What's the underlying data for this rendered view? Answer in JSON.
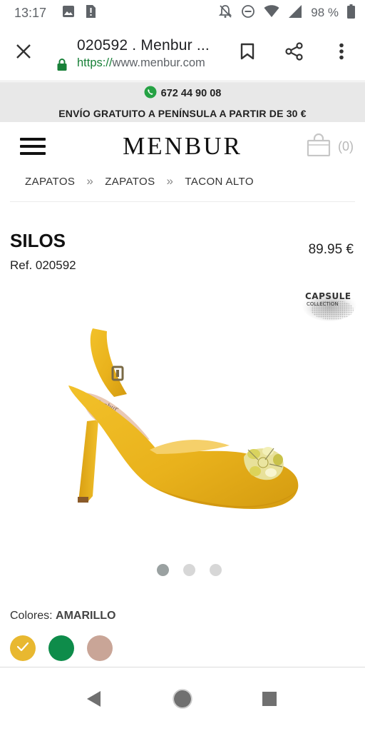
{
  "status_bar": {
    "time": "13:17",
    "battery": "98 %",
    "icons_left": [
      "image-icon",
      "sim-alert-icon"
    ],
    "icons_right": [
      "notifications-off-icon",
      "dnd-icon",
      "wifi-icon",
      "signal-icon",
      "battery-icon"
    ]
  },
  "browser": {
    "page_title": "020592 . Menbur ...",
    "url_scheme": "https://",
    "url_host": "www.menbur.com",
    "colors": {
      "lock": "#188038"
    }
  },
  "promo": {
    "phone": "672 44 90 08",
    "shipping": "ENVÍO GRATUITO A PENÍNSULA A PARTIR DE 30 €"
  },
  "header": {
    "logo": "MENBUR",
    "cart_count": "(0)"
  },
  "breadcrumb": {
    "items": [
      "ZAPATOS",
      "ZAPATOS",
      "TACON ALTO"
    ],
    "separator": "»"
  },
  "product": {
    "name": "SILOS",
    "ref": "Ref. 020592",
    "price": "89.95 €",
    "badge": {
      "line1": "CAPSULE",
      "line2": "COLLECTION"
    },
    "insole_brand": "Menbur",
    "gallery": {
      "count": 3,
      "active_index": 0
    },
    "colors_label": "Colores:",
    "selected_color": "AMARILLO",
    "swatches": [
      {
        "name": "amarillo",
        "hex": "#e8b830",
        "selected": true
      },
      {
        "name": "verde",
        "hex": "#0e8c4a",
        "selected": false
      },
      {
        "name": "nude",
        "hex": "#c9a597",
        "selected": false
      }
    ]
  },
  "nav_bar": {
    "buttons": [
      "back",
      "home",
      "recents"
    ]
  }
}
